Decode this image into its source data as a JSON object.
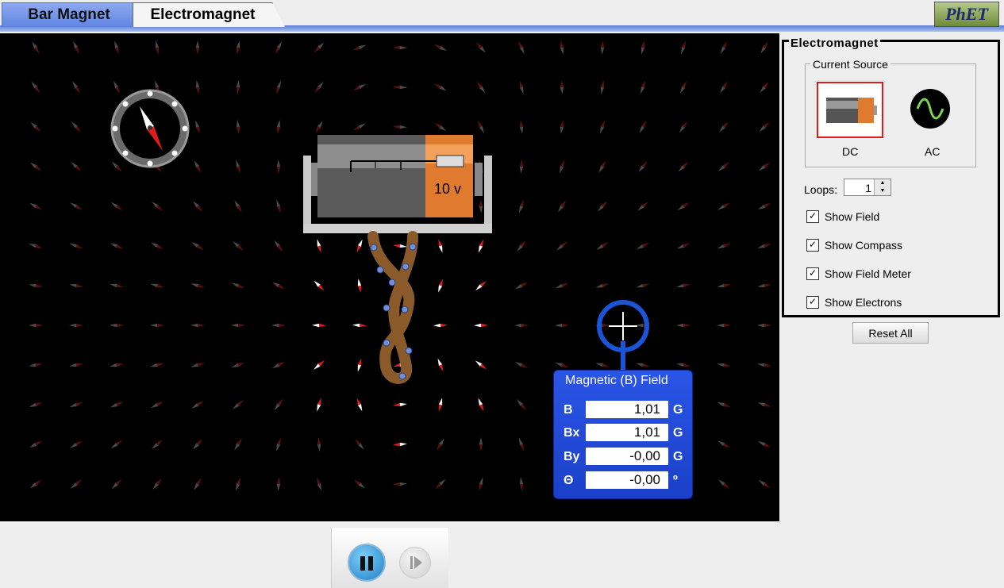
{
  "tabs": [
    {
      "label": "Bar Magnet",
      "active": false
    },
    {
      "label": "Electromagnet",
      "active": true
    }
  ],
  "logo": {
    "text": "PhET"
  },
  "battery": {
    "voltage_label": "10 v"
  },
  "panel": {
    "title": "Electromagnet",
    "current_source": {
      "title": "Current Source",
      "dc_label": "DC",
      "ac_label": "AC",
      "selected": "DC"
    },
    "loops": {
      "label": "Loops:",
      "value": "1"
    },
    "checkboxes": [
      {
        "label": "Show Field",
        "checked": true
      },
      {
        "label": "Show Compass",
        "checked": true
      },
      {
        "label": "Show Field Meter",
        "checked": true
      },
      {
        "label": "Show Electrons",
        "checked": true
      }
    ],
    "reset_label": "Reset All"
  },
  "field_meter": {
    "title": "Magnetic (B) Field",
    "rows": [
      {
        "symbol": "B",
        "value": "1,01",
        "unit": "G"
      },
      {
        "symbol": "Bx",
        "value": "1,01",
        "unit": "G"
      },
      {
        "symbol": "By",
        "value": "-0,00",
        "unit": "G"
      },
      {
        "symbol": "Θ",
        "value": "-0,00",
        "unit": "º"
      }
    ]
  },
  "colors": {
    "tab_inactive": "#6f8fe8",
    "meter_blue": "#1f48d6",
    "needle_red": "#d81a1a",
    "selected_border": "#e31b1b",
    "coil": "#8a5a2b"
  },
  "clock_controls": {
    "pause": "pause-button",
    "step": "step-button"
  }
}
